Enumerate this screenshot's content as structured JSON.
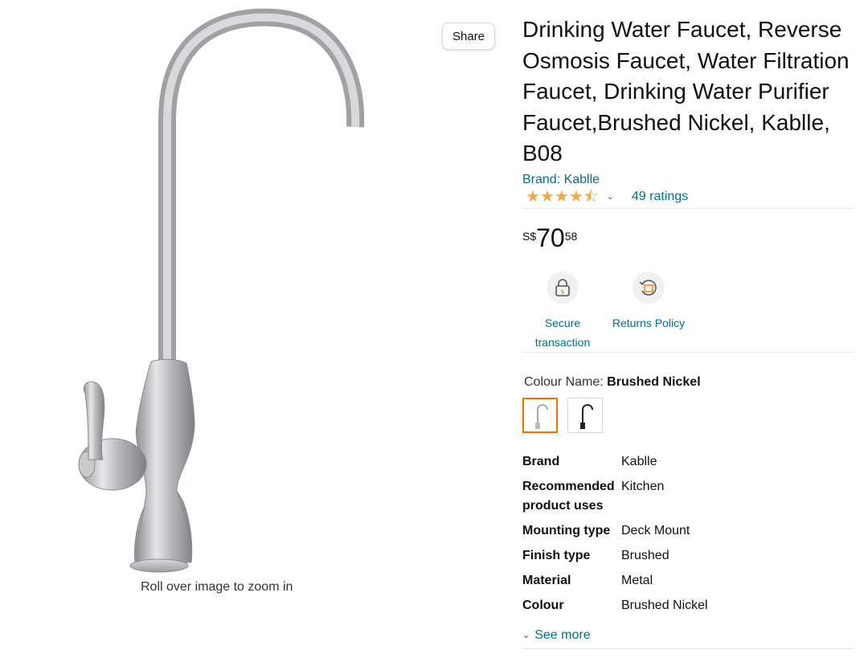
{
  "image_pane": {
    "zoom_hint": "Roll over image to zoom in",
    "share_label": "Share"
  },
  "product": {
    "title": "Drinking Water Faucet, Reverse Osmosis Faucet, Water Filtration Faucet, Drinking Water Purifier Faucet,Brushed Nickel, Kablle, B08",
    "brand_link": "Brand: Kablle",
    "rating_value": 4.5,
    "ratings_count": "49 ratings",
    "price": {
      "currency": "S$",
      "whole": "70",
      "fraction": "58"
    },
    "features": [
      {
        "label": "Secure transaction",
        "icon": "lock-icon"
      },
      {
        "label": "Returns Policy",
        "icon": "returns-box-icon"
      }
    ],
    "colour": {
      "label": "Colour Name:",
      "value": "Brushed Nickel"
    },
    "specs": [
      {
        "key": "Brand",
        "value": "Kablle"
      },
      {
        "key": "Recommended product uses",
        "value": "Kitchen"
      },
      {
        "key": "Mounting type",
        "value": "Deck Mount"
      },
      {
        "key": "Finish type",
        "value": "Brushed"
      },
      {
        "key": "Material",
        "value": "Metal"
      },
      {
        "key": "Colour",
        "value": "Brushed Nickel"
      }
    ],
    "see_more": "See more"
  },
  "colors": {
    "link": "#007185",
    "star": "#f3a847",
    "selected_swatch": "#e77600"
  }
}
